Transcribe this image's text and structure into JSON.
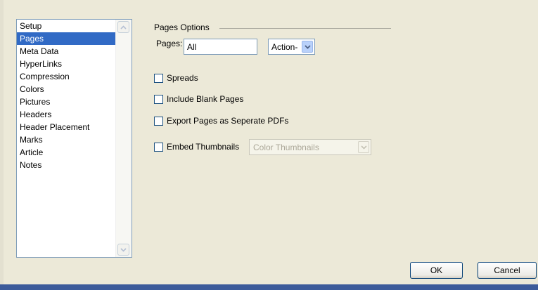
{
  "categories": [
    {
      "label": "Setup",
      "selected": false
    },
    {
      "label": "Pages",
      "selected": true
    },
    {
      "label": "Meta Data",
      "selected": false
    },
    {
      "label": "HyperLinks",
      "selected": false
    },
    {
      "label": "Compression",
      "selected": false
    },
    {
      "label": "Colors",
      "selected": false
    },
    {
      "label": "Pictures",
      "selected": false
    },
    {
      "label": "Headers",
      "selected": false
    },
    {
      "label": "Header Placement",
      "selected": false
    },
    {
      "label": "Marks",
      "selected": false
    },
    {
      "label": "Article",
      "selected": false
    },
    {
      "label": "Notes",
      "selected": false
    }
  ],
  "pages_options": {
    "title": "Pages Options",
    "pages_label": "Pages:",
    "pages_value": "All",
    "action_value": "Action-",
    "checkboxes": {
      "spreads": {
        "label": "Spreads",
        "checked": false
      },
      "include_blank": {
        "label": "Include Blank Pages",
        "checked": false
      },
      "export_separate": {
        "label": "Export Pages as Seperate PDFs",
        "checked": false
      },
      "embed_thumbnails": {
        "label": "Embed Thumbnails",
        "checked": false
      }
    },
    "thumbnail_select_value": "Color Thumbnails"
  },
  "buttons": {
    "ok": "OK",
    "cancel": "Cancel"
  },
  "colors": {
    "dialog_bg": "#ece9d8",
    "selection": "#316ac5",
    "frame": "#3c5b9a"
  }
}
